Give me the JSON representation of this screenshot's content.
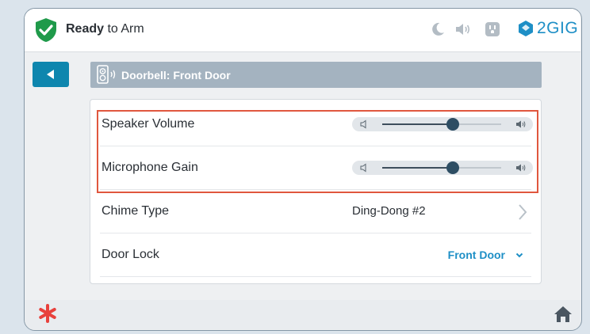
{
  "header": {
    "arm_status_bold": "Ready",
    "arm_status_rest": " to Arm",
    "icons": [
      "moon-icon",
      "speaker-icon",
      "outlet-icon",
      "2gig-logo-icon"
    ],
    "brand": "2GIG"
  },
  "nav": {
    "back_icon": "back-arrow-icon"
  },
  "title_bar": {
    "icon": "doorbell-speaker-icon",
    "title": "Doorbell: Front Door"
  },
  "settings": [
    {
      "label": "Speaker Volume",
      "type": "slider",
      "level_percent": 59
    },
    {
      "label": "Microphone Gain",
      "type": "slider",
      "level_percent": 59
    },
    {
      "label": "Chime Type",
      "type": "link",
      "value": "Ding-Dong #2"
    },
    {
      "label": "Door Lock",
      "type": "dropdown",
      "value": "Front Door"
    }
  ],
  "footer": {
    "left_icon": "emergency-asterisk-icon",
    "right_icon": "home-icon"
  },
  "colors": {
    "accent": "#1e8fc6",
    "back_button": "#0e86ae",
    "title_bar": "#a4b3c0",
    "highlight": "#e0573e",
    "shield": "#1f9a4a",
    "emergency": "#e8413c"
  }
}
